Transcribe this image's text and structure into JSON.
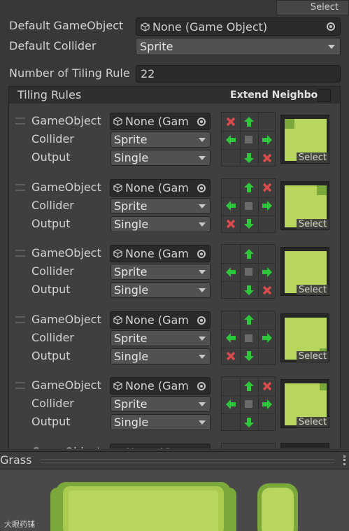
{
  "top_select_label": "Select",
  "default_gameobject": {
    "label": "Default GameObject",
    "value": "None (Game Object)"
  },
  "default_collider": {
    "label": "Default Collider",
    "value": "Sprite"
  },
  "tiling_count": {
    "label": "Number of Tiling Rule",
    "value": "22"
  },
  "tiling_rules": {
    "title": "Tiling Rules",
    "extend_neighbor": "Extend Neighbor"
  },
  "rule_labels": {
    "gameobject": "GameObject",
    "collider": "Collider",
    "output": "Output",
    "select": "Select"
  },
  "rules": [
    {
      "gameobject": "None (Gam",
      "collider": "Sprite",
      "output": "Single",
      "grid": [
        "x",
        "up",
        "",
        "left",
        "c",
        "right",
        "",
        "down",
        "x"
      ],
      "corner": "top-left"
    },
    {
      "gameobject": "None (Gam",
      "collider": "Sprite",
      "output": "Single",
      "grid": [
        "",
        "up",
        "x",
        "left",
        "c",
        "right",
        "x",
        "down",
        ""
      ],
      "corner": "top-right"
    },
    {
      "gameobject": "None (Gam",
      "collider": "Sprite",
      "output": "Single",
      "grid": [
        "",
        "up",
        "",
        "left",
        "c",
        "right",
        "",
        "down",
        "x"
      ],
      "corner": "none"
    },
    {
      "gameobject": "None (Gam",
      "collider": "Sprite",
      "output": "Single",
      "grid": [
        "",
        "up",
        "",
        "left",
        "c",
        "right",
        "x",
        "down",
        ""
      ],
      "corner": "bottom-right"
    },
    {
      "gameobject": "None (Gam",
      "collider": "Sprite",
      "output": "Single",
      "grid": [
        "",
        "up",
        "x",
        "left",
        "c",
        "right",
        "",
        "down",
        ""
      ],
      "corner": "top-right-small"
    }
  ],
  "partial_rule": {
    "gameobject": "None (Gam"
  },
  "preview_panel": {
    "title": "Grass"
  },
  "watermark": "大眼药铺",
  "colors": {
    "background": "#383838",
    "field": "#2a2a2a",
    "dropdown": "#515151",
    "arrow_green": "#2fc63b",
    "cross_red": "#d94a4a",
    "grass_light": "#b8d65e",
    "grass_dark": "#7aa83a"
  }
}
